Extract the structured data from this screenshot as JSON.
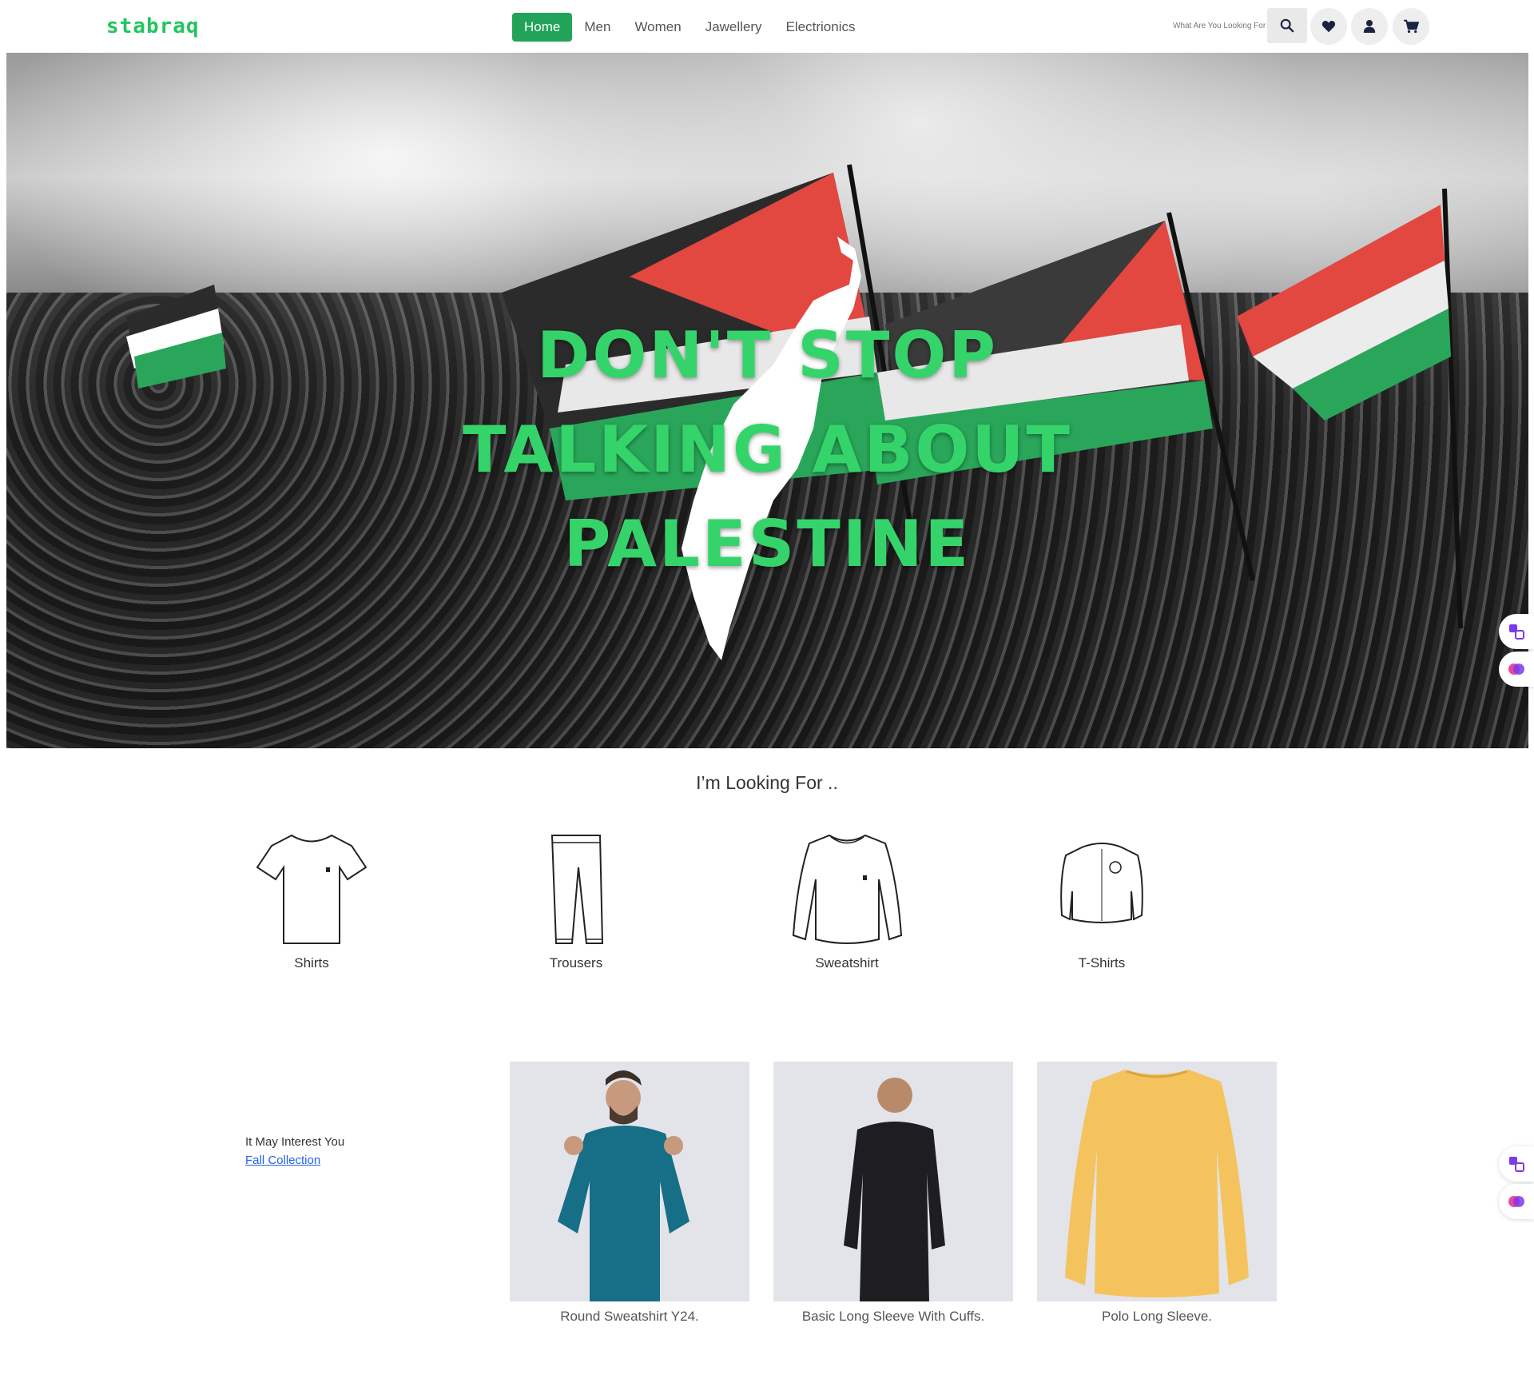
{
  "navbar": {
    "logo": "stabraq",
    "links": [
      "Home",
      "Men",
      "Women",
      "Jawellery",
      "Electrionics"
    ],
    "search_placeholder": "What Are You Looking For",
    "icons": [
      "search-icon",
      "heart-icon",
      "user-icon",
      "cart-icon"
    ]
  },
  "hero": {
    "line1": "DON'T STOP",
    "line2": "TALKING ABOUT",
    "line3": "PALESTINE"
  },
  "looking_for": {
    "title": "I’m Looking For ..",
    "categories": [
      "Shirts",
      "Trousers",
      "Sweatshirt",
      "T-Shirts"
    ]
  },
  "interest": {
    "text": "It May Interest You",
    "link": "Fall Collection",
    "products": [
      {
        "name": "Round Sweatshirt Y24.",
        "color": "#166f86"
      },
      {
        "name": "Basic Long Sleeve With Cuffs.",
        "color": "#1e1e22"
      },
      {
        "name": "Polo Long Sleeve.",
        "color": "#f5c35e"
      }
    ]
  },
  "colors": {
    "brand": "#22c55e",
    "active_nav": "#22a35a",
    "hero_text": "#35d46b"
  }
}
